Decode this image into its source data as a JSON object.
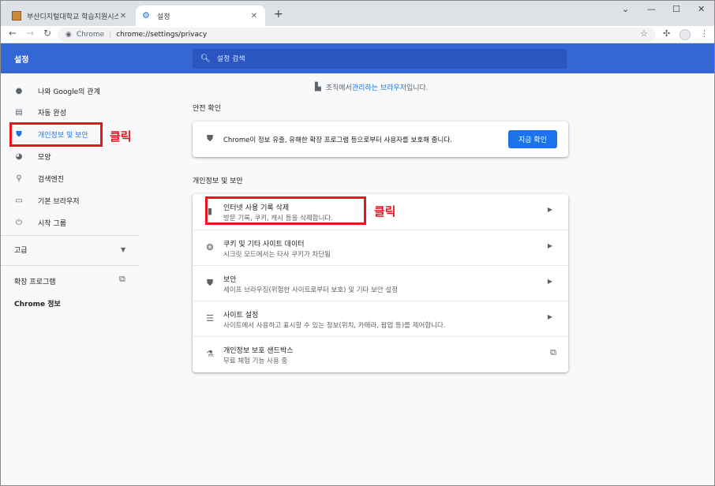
{
  "tabs": [
    {
      "title": "부산디지털대학교 학습지원시스",
      "close": "✕"
    },
    {
      "title": "설정",
      "close": "✕"
    }
  ],
  "newtab": "+",
  "window_controls": [
    "⌄",
    "—",
    "☐",
    "✕"
  ],
  "nav": {
    "back": "←",
    "forward": "→",
    "reload": "↻"
  },
  "omnibox": {
    "site": "Chrome",
    "url": "chrome://settings/privacy"
  },
  "header": {
    "title": "설정",
    "search_placeholder": "설정 검색"
  },
  "sidebar": {
    "items": [
      {
        "label": "나와 Google의 관계"
      },
      {
        "label": "자동 완성"
      },
      {
        "label": "개인정보 및 보안"
      },
      {
        "label": "모양"
      },
      {
        "label": "검색엔진"
      },
      {
        "label": "기본 브라우저"
      },
      {
        "label": "시작 그룹"
      }
    ],
    "advanced": "고급",
    "extensions": "확장 프로그램",
    "about": "Chrome 정보"
  },
  "annotations": {
    "click1": "클릭",
    "click2": "클릭"
  },
  "managed": {
    "prefix": "조직에서 ",
    "link": "관리하는 브라우저",
    "suffix": "입니다."
  },
  "safety": {
    "title": "안전 확인",
    "text": "Chrome이 정보 유출, 유해한 확장 프로그램 등으로부터 사용자를 보호해 줍니다.",
    "button": "지금 확인"
  },
  "privacy": {
    "title": "개인정보 및 보안",
    "rows": [
      {
        "title": "인터넷 사용 기록 삭제",
        "sub": "방문 기록, 쿠키, 캐시 등을 삭제합니다."
      },
      {
        "title": "쿠키 및 기타 사이트 데이터",
        "sub": "시크릿 모드에서는 타사 쿠키가 차단됨"
      },
      {
        "title": "보안",
        "sub": "세이프 브라우징(위험한 사이트로부터 보호) 및 기타 보안 설정"
      },
      {
        "title": "사이트 설정",
        "sub": "사이트에서 사용하고 표시할 수 있는 정보(위치, 카메라, 팝업 등)를 제어합니다."
      },
      {
        "title": "개인정보 보호 샌드박스",
        "sub": "무료 체험 기능 사용 중"
      }
    ]
  },
  "colors": {
    "accent": "#1a73e8",
    "header": "#3367d6",
    "annotation": "#e8141e"
  }
}
